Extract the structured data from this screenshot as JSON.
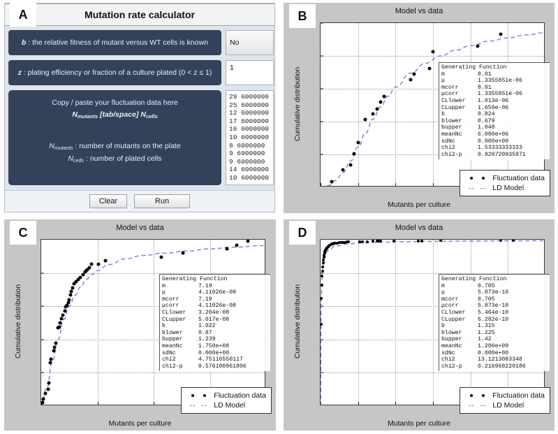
{
  "panels": {
    "a": {
      "letter": "A",
      "title": "Mutation rate calculator",
      "rows": [
        {
          "prompt_prefix": "b",
          "prompt_text": " : the relative fitness of mutant versus WT cells is known",
          "value": "No",
          "control": "select"
        },
        {
          "prompt_prefix": "z",
          "prompt_text": " : plating efficiency or fraction of a culture plated (0 < z ≤ 1)",
          "value": "1",
          "control": "text"
        }
      ],
      "paste_area": {
        "line1": "Copy / paste your fluctuation data here",
        "line2_a": "N",
        "line2_sub_a": "mutants",
        "line2_mid": " [tab/space] ",
        "line2_b": "N",
        "line2_sub_b": "cells",
        "line3_a": "N",
        "line3_sub_a": "mutants",
        "line3_text": " : number of mutants on the plate",
        "line4_a": "N",
        "line4_sub_a": "cells",
        "line4_text": " : number of plated cells"
      },
      "data_text": "29 6000000\n25 6000000\n12 6000000\n17 6000000\n16 6000000\n10 6000000\n8 6000000\n9 6000000\n9 6000000\n14 6000000\n10 6000000",
      "buttons": {
        "clear": "Clear",
        "run": "Run"
      }
    },
    "b": {
      "letter": "B",
      "generating_function": {
        "title": "Generating Function",
        "rows": [
          [
            "m",
            "8.01"
          ],
          [
            "μ",
            "1.3355851e-06"
          ],
          [
            "mcorr",
            "8.01"
          ],
          [
            "μcorr",
            "1.3355851e-06"
          ],
          [
            "CLlower",
            "1.013e-06"
          ],
          [
            "CLupper",
            "1.659e-06"
          ],
          [
            "b",
            "0.824"
          ],
          [
            "blower",
            "0.679"
          ],
          [
            "bupper",
            "1.048"
          ],
          [
            "meanNc",
            "6.000e+06"
          ],
          [
            "sdNc",
            "0.000e+00"
          ],
          [
            "chi2",
            "1.53333333333"
          ],
          [
            "chi2-p",
            "0.820720935971"
          ]
        ]
      }
    },
    "c": {
      "letter": "C",
      "generating_function": {
        "title": "Generating Function",
        "rows": [
          [
            "m",
            "7.19"
          ],
          [
            "μ",
            "4.11026e-08"
          ],
          [
            "mcorr",
            "7.19"
          ],
          [
            "μcorr",
            "4.11026e-08"
          ],
          [
            "CLlower",
            "3.204e-08"
          ],
          [
            "CLupper",
            "5.017e-08"
          ],
          [
            "b",
            "1.022"
          ],
          [
            "blower",
            "0.87"
          ],
          [
            "bupper",
            "1.239"
          ],
          [
            "meanNc",
            "1.750e+08"
          ],
          [
            "sdNc",
            "0.000e+00"
          ],
          [
            "chi2",
            "4.75116550117"
          ],
          [
            "chi2-p",
            "0.576100961806"
          ]
        ]
      }
    },
    "d": {
      "letter": "D",
      "generating_function": {
        "title": "Generating Function",
        "rows": [
          [
            "m",
            "0.705"
          ],
          [
            "μ",
            "5.873e-10"
          ],
          [
            "mcorr",
            "0.705"
          ],
          [
            "μcorr",
            "5.873e-10"
          ],
          [
            "CLlower",
            "5.464e-10"
          ],
          [
            "CLupper",
            "6.282e-10"
          ],
          [
            "b",
            "1.315"
          ],
          [
            "blower",
            "1.225"
          ],
          [
            "bupper",
            "1.42"
          ],
          [
            "meanNc",
            "1.200e+09"
          ],
          [
            "sdNc",
            "0.000e+00"
          ],
          [
            "chi2",
            "13.1213083348"
          ],
          [
            "chi2-p",
            "0.216968220186"
          ]
        ]
      }
    }
  },
  "legend": {
    "data_label": "Fluctuation data",
    "model_label": "LD Model"
  },
  "colors": {
    "model_line": "#7b7bdd",
    "data_point": "#000000",
    "panel_bg": "#c6c6c6",
    "prompt_bg": "#344259"
  },
  "chart_data": [
    {
      "id": "B",
      "type": "scatter",
      "title": "Model vs data",
      "xlabel": "Mutants per culture",
      "ylabel": "Cumulative distribution",
      "xlim": [
        0,
        60
      ],
      "ylim": [
        0.0,
        1.0
      ],
      "xticks": [
        0,
        10,
        20,
        30,
        40,
        50,
        60
      ],
      "yticks": [
        0.0,
        0.2,
        0.4,
        0.6,
        0.8,
        1.0
      ],
      "grid": true,
      "legend_position": "lower right",
      "series": [
        {
          "name": "Fluctuation data",
          "marker": "o",
          "x": [
            3,
            6,
            8,
            9,
            10,
            12,
            14,
            15,
            16,
            17,
            24,
            25,
            29,
            30,
            42,
            48
          ],
          "y": [
            0.033,
            0.105,
            0.135,
            0.205,
            0.273,
            0.412,
            0.445,
            0.478,
            0.518,
            0.552,
            0.655,
            0.688,
            0.722,
            0.825,
            0.858,
            0.932
          ]
        },
        {
          "name": "LD Model",
          "marker": "dashed-line",
          "x": [
            0,
            2,
            4,
            6,
            8,
            10,
            12,
            14,
            16,
            18,
            20,
            24,
            28,
            32,
            36,
            40,
            45,
            50,
            55,
            60
          ],
          "y": [
            0.0,
            0.01,
            0.04,
            0.09,
            0.16,
            0.245,
            0.33,
            0.415,
            0.49,
            0.555,
            0.61,
            0.695,
            0.755,
            0.8,
            0.835,
            0.862,
            0.89,
            0.91,
            0.928,
            0.942
          ]
        }
      ]
    },
    {
      "id": "C",
      "type": "scatter",
      "title": "Model vs data",
      "xlabel": "Mutants per culture",
      "ylabel": "Cumulative distribution",
      "xlim": [
        0,
        200
      ],
      "ylim": [
        0.0,
        1.0
      ],
      "xticks": [
        0,
        50,
        100,
        150,
        200
      ],
      "yticks": [
        0.0,
        0.2,
        0.4,
        0.6,
        0.8
      ],
      "grid": true,
      "legend_position": "lower right",
      "series": [
        {
          "name": "Fluctuation data",
          "marker": "o",
          "x": [
            1,
            2,
            4,
            6,
            7,
            8,
            9,
            11,
            12,
            13,
            15,
            16,
            17,
            18,
            19,
            21,
            22,
            23,
            24,
            25,
            26,
            27,
            28,
            29,
            31,
            33,
            35,
            37,
            39,
            40,
            41,
            43,
            45,
            51,
            57,
            107,
            126,
            165,
            174,
            184
          ],
          "y": [
            0.02,
            0.04,
            0.075,
            0.1,
            0.14,
            0.26,
            0.28,
            0.33,
            0.355,
            0.378,
            0.47,
            0.475,
            0.5,
            0.525,
            0.545,
            0.57,
            0.595,
            0.605,
            0.62,
            0.64,
            0.67,
            0.69,
            0.71,
            0.735,
            0.75,
            0.762,
            0.775,
            0.79,
            0.805,
            0.812,
            0.818,
            0.83,
            0.852,
            0.855,
            0.875,
            0.895,
            0.922,
            0.945,
            0.968,
            0.993
          ]
        },
        {
          "name": "LD Model",
          "marker": "dashed-line",
          "x": [
            0,
            5,
            10,
            15,
            20,
            25,
            30,
            35,
            40,
            45,
            50,
            60,
            75,
            90,
            110,
            130,
            150,
            170,
            200
          ],
          "y": [
            0.0,
            0.11,
            0.27,
            0.4,
            0.52,
            0.6,
            0.665,
            0.715,
            0.76,
            0.79,
            0.815,
            0.85,
            0.885,
            0.905,
            0.92,
            0.932,
            0.945,
            0.955,
            0.965
          ]
        }
      ]
    },
    {
      "id": "D",
      "type": "scatter",
      "title": "Model vs data",
      "xlabel": "Mutants per culture",
      "ylabel": "Cumulative distribution",
      "xlim": [
        0,
        600
      ],
      "ylim": [
        0.0,
        1.0
      ],
      "xticks": [
        0,
        100,
        200,
        300,
        400,
        500,
        600
      ],
      "yticks": [
        0.0,
        0.2,
        0.4,
        0.6,
        0.8
      ],
      "grid": true,
      "legend_position": "lower right",
      "series": [
        {
          "name": "Fluctuation data",
          "marker": "o",
          "x": [
            1,
            2,
            3,
            4,
            5,
            6,
            7,
            8,
            9,
            10,
            11,
            12,
            13,
            14,
            15,
            16,
            18,
            20,
            22,
            25,
            28,
            30,
            33,
            36,
            40,
            45,
            50,
            55,
            60,
            65,
            70,
            75,
            105,
            112,
            125,
            140,
            150,
            155,
            160,
            195,
            260,
            270,
            320,
            480,
            515
          ],
          "y": [
            0.49,
            0.645,
            0.725,
            0.78,
            0.81,
            0.835,
            0.86,
            0.88,
            0.895,
            0.908,
            0.92,
            0.928,
            0.935,
            0.94,
            0.945,
            0.949,
            0.955,
            0.96,
            0.963,
            0.968,
            0.971,
            0.973,
            0.975,
            0.977,
            0.979,
            0.981,
            0.982,
            0.983,
            0.984,
            0.985,
            0.986,
            0.987,
            0.988,
            0.988,
            0.989,
            0.99,
            0.99,
            0.991,
            0.991,
            0.992,
            0.993,
            0.993,
            0.994,
            0.995,
            0.996
          ]
        },
        {
          "name": "LD Model",
          "marker": "dashed-line",
          "x": [
            0,
            2,
            5,
            10,
            20,
            40,
            70,
            110,
            160,
            220,
            300,
            400,
            500,
            600
          ],
          "y": [
            0.0,
            0.66,
            0.81,
            0.89,
            0.935,
            0.962,
            0.974,
            0.981,
            0.985,
            0.988,
            0.99,
            0.992,
            0.993,
            0.994
          ]
        }
      ]
    }
  ]
}
